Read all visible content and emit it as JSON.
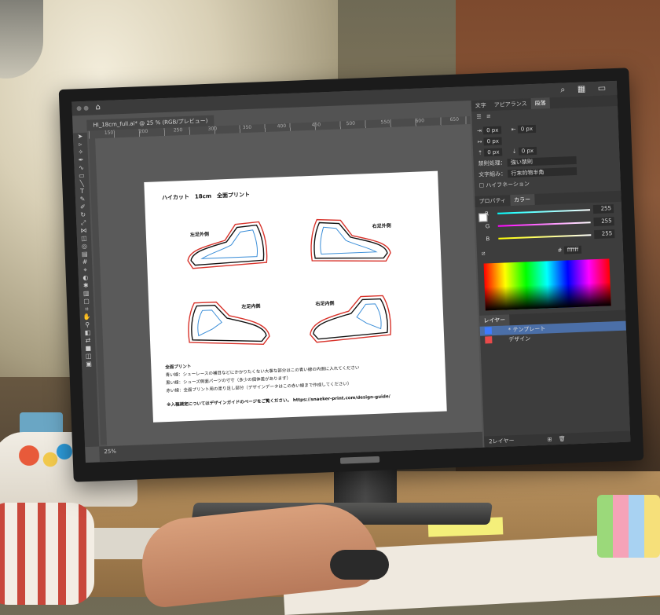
{
  "document": {
    "tab_title": "HI_18cm_full.ai* @ 25 % (RGB/プレビュー)",
    "ruler_ticks": [
      "150",
      "200",
      "250",
      "300",
      "350",
      "400",
      "450",
      "500",
      "550",
      "600",
      "650"
    ],
    "status_zoom": "25%"
  },
  "artboard": {
    "title": "ハイカット　18cm　全面プリント",
    "labels": {
      "left_outer": "左足外側",
      "right_outer": "右足外側",
      "left_inner": "左足内側",
      "right_inner": "右足内側"
    },
    "notes_heading": "全面プリント",
    "notes": [
      "青い線：シューレースの補目などにかかりたくない大事な部分はこの青い線の内側に入れてください",
      "黒い線：シューズ側面パーツの寸寸（多少の個体差があります）",
      "赤い線：全面プリント用の塗り足し部分（デザインデータはこの赤い線まで作成してください）"
    ],
    "footer": "※入稿規定についてはデザインガイドのページをご覧ください。 https://snaeker-print.com/design-guide/"
  },
  "panel": {
    "tabs": [
      "文字",
      "アピアランス",
      "段落"
    ],
    "active_tab": "段落",
    "indent_values": [
      "0 px",
      "0 px",
      "0 px",
      "0 px",
      "0 px"
    ],
    "kinsoku_label": "禁則処理：",
    "kinsoku_value": "強い禁則",
    "mojigumi_label": "文字組み：",
    "mojigumi_value": "行末約物半角",
    "hyphenation": "ハイフネーション",
    "color_tabs": [
      "プロパティ",
      "カラー"
    ],
    "color_channels": [
      {
        "name": "R",
        "value": "255",
        "color": "#e0383c"
      },
      {
        "name": "G",
        "value": "255",
        "color": "#2fb64a"
      },
      {
        "name": "B",
        "value": "255",
        "color": "#3a6fd8"
      }
    ],
    "hex_value": "ffffff",
    "layers_tab": "レイヤー",
    "layers": [
      {
        "name": "* テンプレート",
        "color": "#3e7bff"
      },
      {
        "name": "デザイン",
        "color": "#e94a4a"
      }
    ],
    "layers_count": "2レイヤー"
  },
  "colors": {
    "line_red": "#d8332b",
    "line_black": "#111111",
    "line_blue": "#3b8ed8"
  }
}
